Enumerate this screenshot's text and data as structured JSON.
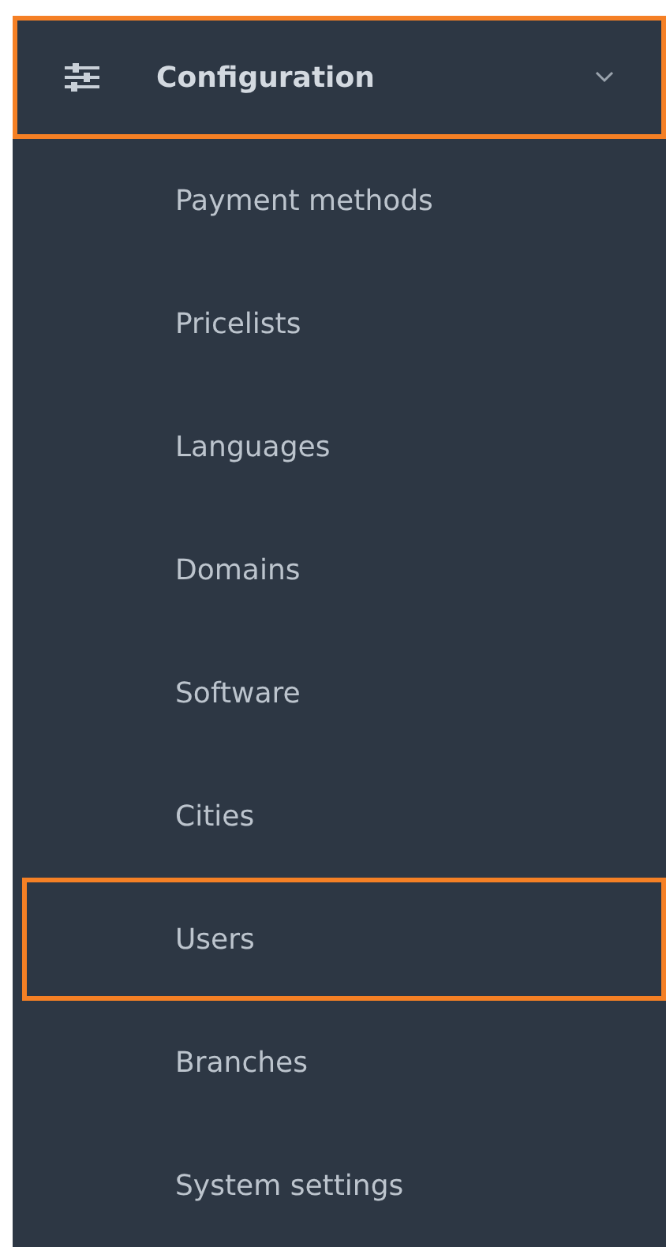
{
  "menu": {
    "label": "Configuration",
    "expanded": true,
    "highlighted": true,
    "items": [
      {
        "label": "Payment methods",
        "highlighted": false
      },
      {
        "label": "Pricelists",
        "highlighted": false
      },
      {
        "label": "Languages",
        "highlighted": false
      },
      {
        "label": "Domains",
        "highlighted": false
      },
      {
        "label": "Software",
        "highlighted": false
      },
      {
        "label": "Cities",
        "highlighted": false
      },
      {
        "label": "Users",
        "highlighted": true
      },
      {
        "label": "Branches",
        "highlighted": false
      },
      {
        "label": "System settings",
        "highlighted": false
      }
    ]
  }
}
